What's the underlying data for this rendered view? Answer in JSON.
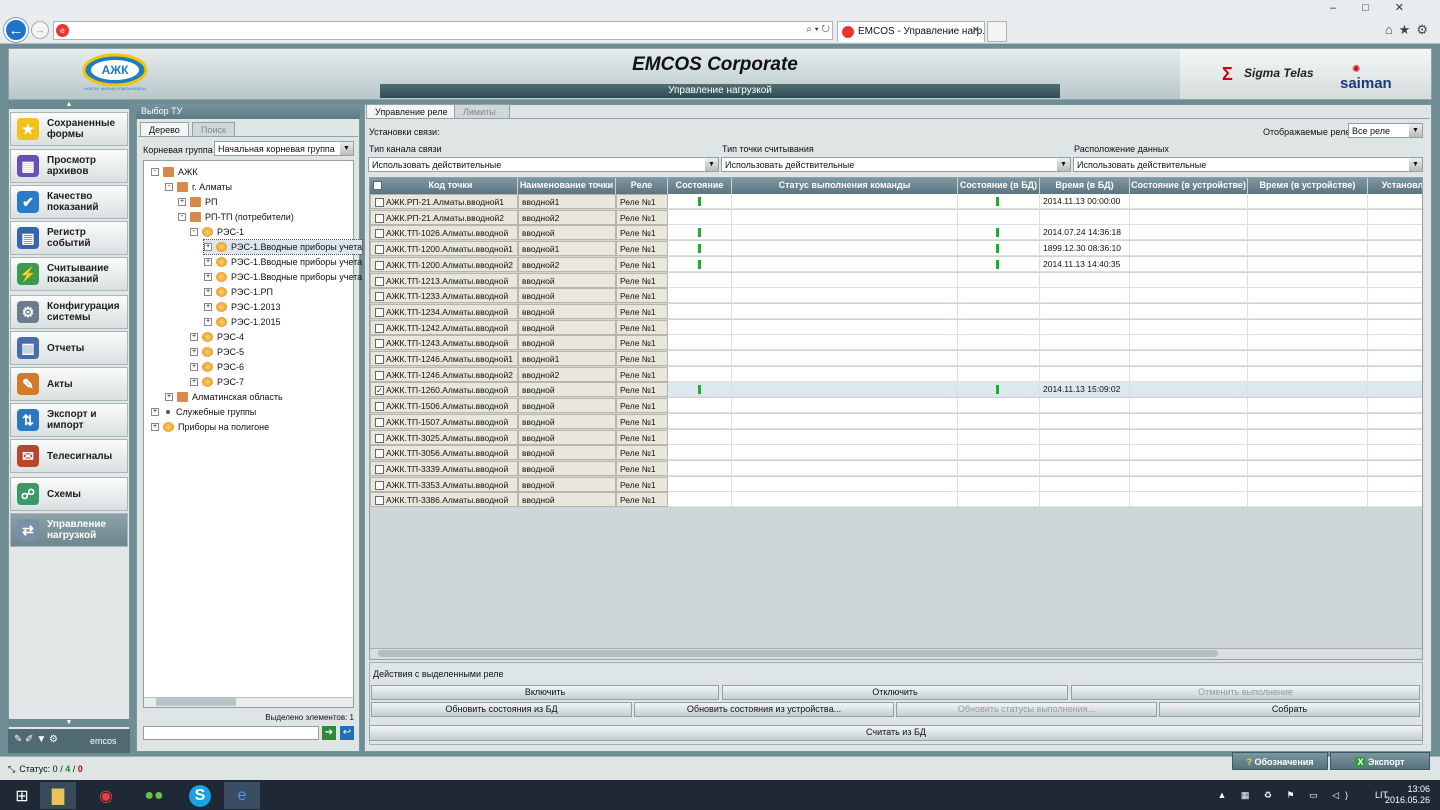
{
  "browser": {
    "tab_title": "EMCOS - Управление нагр...",
    "tab_close": "✕",
    "window_controls": "–□✕",
    "tools": "⌂★⚙",
    "address_tools": "⌕ ▾ ↻"
  },
  "header": {
    "company_logo_text": "АЖК",
    "company_sub": "АЛАТАУ ЖАРЫҚ КОМПАНИЯСЫ",
    "app_title": "EMCOS Corporate",
    "section_title": "Управление нагрузкой",
    "brand1": "Sigma Telas",
    "brand2": "saiman"
  },
  "nav": {
    "items": [
      {
        "label": "Сохраненные формы",
        "icon": "star-icon"
      },
      {
        "label": "Просмотр архивов",
        "icon": "archive-icon"
      },
      {
        "label": "Качество показаний",
        "icon": "quality-icon"
      },
      {
        "label": "Регистр событий",
        "icon": "book-icon"
      },
      {
        "label": "Считывание показаний",
        "icon": "meter-icon"
      },
      {
        "label": "Конфигурация системы",
        "icon": "config-icon"
      },
      {
        "label": "Отчеты",
        "icon": "report-icon"
      },
      {
        "label": "Акты",
        "icon": "act-icon"
      },
      {
        "label": "Экспорт и импорт",
        "icon": "export-icon"
      },
      {
        "label": "Телесигналы",
        "icon": "telesignal-icon"
      },
      {
        "label": "Схемы",
        "icon": "scheme-icon"
      },
      {
        "label": "Управление нагрузкой",
        "icon": "load-icon"
      }
    ],
    "bottom_user": "emcos"
  },
  "tree": {
    "panel_title": "Выбор ТУ",
    "tab_tree": "Дерево",
    "tab_search": "Поиск",
    "root_label": "Корневая группа",
    "root_value": "Начальная корневая группа",
    "nodes": [
      "АЖК",
      "г. Алматы",
      "РП",
      "РП-ТП (потребители)",
      "РЭС-1",
      "РЭС-1.Вводные приборы учета",
      "РЭС-1.Вводные приборы учета",
      "РЭС-1.Вводные приборы учета",
      "РЭС-1.РП",
      "РЭС-1.2013",
      "РЭС-1.2015",
      "РЭС-4",
      "РЭС-5",
      "РЭС-6",
      "РЭС-7",
      "Алматинская область",
      "Служебные группы",
      "Приборы на полигоне"
    ],
    "selected_count": "Выделено элементов: 1"
  },
  "main": {
    "tab_relay": "Управление реле",
    "tab_limits": "Лимиты",
    "conn_settings": "Установки связи:",
    "relay_display_label": "Отображаемые реле",
    "relay_display_value": "Все реле",
    "channel_type_label": "Тип канала связи",
    "channel_type_value": "Использовать действительные",
    "point_type_label": "Тип точки считывания",
    "point_type_value": "Использовать действительные",
    "data_location_label": "Расположение данных",
    "data_location_value": "Использовать действительные"
  },
  "grid": {
    "headers": [
      "Код точки",
      "Наименование точки",
      "Реле",
      "Состояние",
      "Статус выполнения команды",
      "Состояние (в БД)",
      "Время (в БД)",
      "Состояние (в устройстве)",
      "Время (в устройстве)",
      "Установл"
    ],
    "rows": [
      {
        "code": "АЖК.РП-21.Алматы.вводной1",
        "name": "вводной1",
        "relay": "Реле №1",
        "state": true,
        "db_state": true,
        "db_time": "2014.11.13 00:00:00",
        "checked": false
      },
      {
        "code": "АЖК.РП-21.Алматы.вводной2",
        "name": "вводной2",
        "relay": "Реле №1",
        "state": false,
        "db_state": false,
        "db_time": "",
        "checked": false
      },
      {
        "code": "АЖК.ТП-1026.Алматы.вводной",
        "name": "вводной",
        "relay": "Реле №1",
        "state": true,
        "db_state": true,
        "db_time": "2014.07.24 14:36:18",
        "checked": false
      },
      {
        "code": "АЖК.ТП-1200.Алматы.вводной1",
        "name": "вводной1",
        "relay": "Реле №1",
        "state": true,
        "db_state": true,
        "db_time": "1899.12.30 08:36:10",
        "checked": false
      },
      {
        "code": "АЖК.ТП-1200.Алматы.вводной2",
        "name": "вводной2",
        "relay": "Реле №1",
        "state": true,
        "db_state": true,
        "db_time": "2014.11.13 14:40:35",
        "checked": false
      },
      {
        "code": "АЖК.ТП-1213.Алматы.вводной",
        "name": "вводной",
        "relay": "Реле №1",
        "state": false,
        "db_state": false,
        "db_time": "",
        "checked": false
      },
      {
        "code": "АЖК.ТП-1233.Алматы.вводной",
        "name": "вводной",
        "relay": "Реле №1",
        "state": false,
        "db_state": false,
        "db_time": "",
        "checked": false
      },
      {
        "code": "АЖК.ТП-1234.Алматы.вводной",
        "name": "вводной",
        "relay": "Реле №1",
        "state": false,
        "db_state": false,
        "db_time": "",
        "checked": false
      },
      {
        "code": "АЖК.ТП-1242.Алматы.вводной",
        "name": "вводной",
        "relay": "Реле №1",
        "state": false,
        "db_state": false,
        "db_time": "",
        "checked": false
      },
      {
        "code": "АЖК.ТП-1243.Алматы.вводной",
        "name": "вводной",
        "relay": "Реле №1",
        "state": false,
        "db_state": false,
        "db_time": "",
        "checked": false
      },
      {
        "code": "АЖК.ТП-1246.Алматы.вводной1",
        "name": "вводной1",
        "relay": "Реле №1",
        "state": false,
        "db_state": false,
        "db_time": "",
        "checked": false
      },
      {
        "code": "АЖК.ТП-1246.Алматы.вводной2",
        "name": "вводной2",
        "relay": "Реле №1",
        "state": false,
        "db_state": false,
        "db_time": "",
        "checked": false
      },
      {
        "code": "АЖК.ТП-1260.Алматы.вводной",
        "name": "вводной",
        "relay": "Реле №1",
        "state": true,
        "db_state": true,
        "db_time": "2014.11.13 15:09:02",
        "checked": true
      },
      {
        "code": "АЖК.ТП-1506.Алматы.вводной",
        "name": "вводной",
        "relay": "Реле №1",
        "state": false,
        "db_state": false,
        "db_time": "",
        "checked": false
      },
      {
        "code": "АЖК.ТП-1507.Алматы.вводной",
        "name": "вводной",
        "relay": "Реле №1",
        "state": false,
        "db_state": false,
        "db_time": "",
        "checked": false
      },
      {
        "code": "АЖК.ТП-3025.Алматы.вводной",
        "name": "вводной",
        "relay": "Реле №1",
        "state": false,
        "db_state": false,
        "db_time": "",
        "checked": false
      },
      {
        "code": "АЖК.ТП-3056.Алматы.вводной",
        "name": "вводной",
        "relay": "Реле №1",
        "state": false,
        "db_state": false,
        "db_time": "",
        "checked": false
      },
      {
        "code": "АЖК.ТП-3339.Алматы.вводной",
        "name": "вводной",
        "relay": "Реле №1",
        "state": false,
        "db_state": false,
        "db_time": "",
        "checked": false
      },
      {
        "code": "АЖК.ТП-3353.Алматы.вводной",
        "name": "вводной",
        "relay": "Реле №1",
        "state": false,
        "db_state": false,
        "db_time": "",
        "checked": false
      },
      {
        "code": "АЖК.ТП-3386.Алматы.вводной",
        "name": "вводной",
        "relay": "Реле №1",
        "state": false,
        "db_state": false,
        "db_time": "",
        "checked": false
      }
    ]
  },
  "actions": {
    "title": "Действия с выделенными реле",
    "enable": "Включить",
    "disable": "Отключить",
    "cancel_exec": "Отменить выполнение",
    "update_db": "Обновить состояния из БД",
    "update_device": "Обновить состояния из устройства...",
    "update_exec": "Обновить статусы выполнения...",
    "collect": "Собрать",
    "read_db": "Считать из БД"
  },
  "status": {
    "label": "Статус:",
    "v0": "0",
    "v1": "4",
    "v2": "0",
    "legend_button": "Обозначения",
    "export_button": "Экспорт"
  },
  "taskbar": {
    "lang": "LIT",
    "time": "13:06",
    "date": "2016.05.26"
  },
  "colors": {
    "state_on": "#1fad2c",
    "accent": "#5a7480"
  }
}
